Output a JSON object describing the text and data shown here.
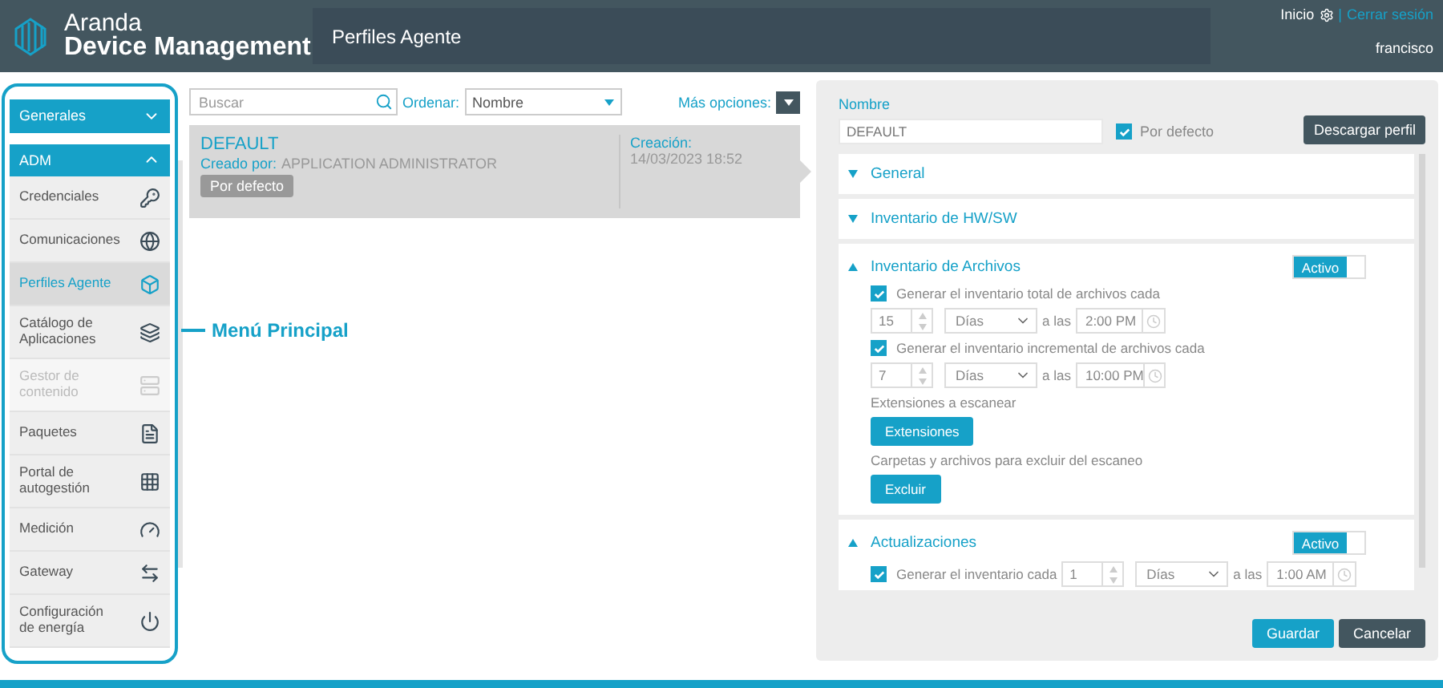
{
  "header": {
    "logo_line1": "Aranda",
    "logo_line2": "Device Management",
    "page_title": "Perfiles Agente",
    "home_link": "Inicio",
    "separator": "|",
    "logout_link": "Cerrar sesión",
    "user": "francisco"
  },
  "sidebar": {
    "groups": [
      {
        "label": "Generales",
        "expanded": false
      },
      {
        "label": "ADM",
        "expanded": true,
        "items": [
          {
            "label": "Credenciales",
            "selected": false,
            "disabled": false
          },
          {
            "label": "Comunicaciones",
            "selected": false,
            "disabled": false
          },
          {
            "label": "Perfiles Agente",
            "selected": true,
            "disabled": false
          },
          {
            "label": "Catálogo de Aplicaciones",
            "selected": false,
            "disabled": false
          },
          {
            "label": "Gestor de contenido",
            "selected": false,
            "disabled": true
          },
          {
            "label": "Paquetes",
            "selected": false,
            "disabled": false
          },
          {
            "label": "Portal de autogestión",
            "selected": false,
            "disabled": false
          },
          {
            "label": "Medición",
            "selected": false,
            "disabled": false
          },
          {
            "label": "Gateway",
            "selected": false,
            "disabled": false
          },
          {
            "label": "Configuración de energía",
            "selected": false,
            "disabled": false
          }
        ]
      }
    ]
  },
  "annotation": "Menú Principal",
  "list_toolbar": {
    "search": {
      "placeholder": "Buscar"
    },
    "sort_label": "Ordenar:",
    "sort_value": "Nombre",
    "more_options": "Más opciones:"
  },
  "profiles": [
    {
      "name": "DEFAULT",
      "creator_label": "Creado por:",
      "creator": "APPLICATION ADMINISTRATOR",
      "badge": "Por defecto",
      "created_label": "Creación:",
      "created": "14/03/2023 18:52",
      "selected": true
    }
  ],
  "form": {
    "name_label": "Nombre",
    "name_value": "DEFAULT",
    "default_checkbox": {
      "label": "Por defecto",
      "checked": true
    },
    "download_button": "Descargar perfil",
    "sections": [
      {
        "title": "General",
        "expanded": false
      },
      {
        "title": "Inventario de HW/SW",
        "expanded": false
      },
      {
        "title": "Inventario de Archivos",
        "expanded": true,
        "toggle": {
          "label": "Activo",
          "on": true
        },
        "rows": [
          {
            "kind": "schedule",
            "label": "Generar el inventario total de archivos cada",
            "checked": true,
            "number": "15",
            "unit": "Días",
            "at_label": "a las",
            "time": "2:00 PM"
          },
          {
            "kind": "schedule",
            "label": "Generar el inventario incremental de archivos cada",
            "checked": true,
            "number": "7",
            "unit": "Días",
            "at_label": "a las",
            "time": "10:00 PM"
          },
          {
            "kind": "text",
            "label": "Extensiones a escanear"
          },
          {
            "kind": "button",
            "label": "Extensiones"
          },
          {
            "kind": "text",
            "label": "Carpetas y archivos para excluir del escaneo"
          },
          {
            "kind": "button",
            "label": "Excluir"
          }
        ]
      },
      {
        "title": "Actualizaciones",
        "expanded": true,
        "toggle": {
          "label": "Activo",
          "on": true
        },
        "rows": [
          {
            "kind": "inline_schedule",
            "label": "Generar el inventario cada",
            "checked": true,
            "number": "1",
            "unit": "Días",
            "at_label": "a las",
            "time": "1:00 AM"
          }
        ]
      }
    ]
  },
  "buttons": [
    {
      "label": "Guardar",
      "kind": "primary"
    },
    {
      "label": "Cancelar",
      "kind": "secondary"
    }
  ]
}
